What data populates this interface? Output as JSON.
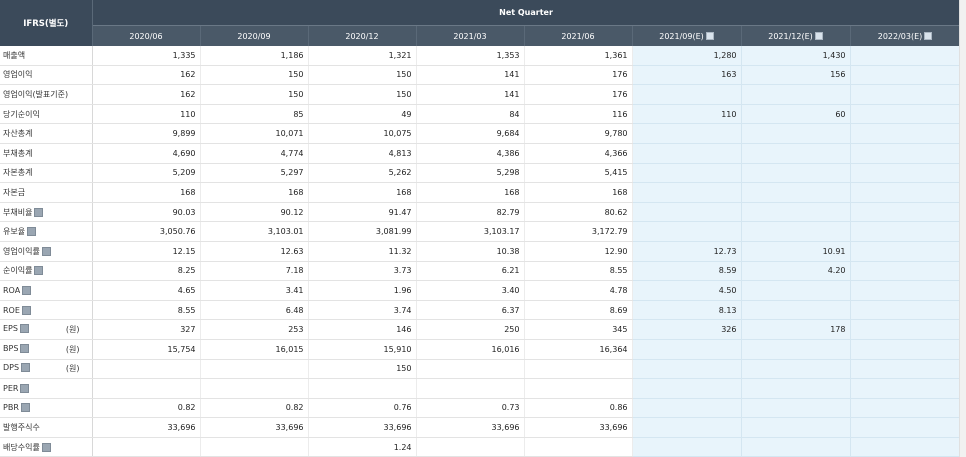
{
  "header": {
    "ifrs_label": "IFRS(별도)",
    "group_label": "Net Quarter",
    "columns": [
      "2020/06",
      "2020/09",
      "2020/12",
      "2021/03",
      "2021/06",
      "2021/09(E)",
      "2021/12(E)",
      "2022/03(E)"
    ]
  },
  "rows": [
    {
      "label": "매출액",
      "info": false,
      "unit": "",
      "values": [
        "1,335",
        "1,186",
        "1,321",
        "1,353",
        "1,361",
        "1,280",
        "1,430",
        ""
      ]
    },
    {
      "label": "영업이익",
      "info": false,
      "unit": "",
      "values": [
        "162",
        "150",
        "150",
        "141",
        "176",
        "163",
        "156",
        ""
      ]
    },
    {
      "label": "영업이익(발표기준)",
      "info": false,
      "unit": "",
      "values": [
        "162",
        "150",
        "150",
        "141",
        "176",
        "",
        "",
        ""
      ]
    },
    {
      "label": "당기순이익",
      "info": false,
      "unit": "",
      "values": [
        "110",
        "85",
        "49",
        "84",
        "116",
        "110",
        "60",
        ""
      ]
    },
    {
      "label": "자산총계",
      "info": false,
      "unit": "",
      "values": [
        "9,899",
        "10,071",
        "10,075",
        "9,684",
        "9,780",
        "",
        "",
        ""
      ]
    },
    {
      "label": "부채총계",
      "info": false,
      "unit": "",
      "values": [
        "4,690",
        "4,774",
        "4,813",
        "4,386",
        "4,366",
        "",
        "",
        ""
      ]
    },
    {
      "label": "자본총계",
      "info": false,
      "unit": "",
      "values": [
        "5,209",
        "5,297",
        "5,262",
        "5,298",
        "5,415",
        "",
        "",
        ""
      ]
    },
    {
      "label": "자본금",
      "info": false,
      "unit": "",
      "values": [
        "168",
        "168",
        "168",
        "168",
        "168",
        "",
        "",
        ""
      ]
    },
    {
      "label": "부채비율",
      "info": true,
      "unit": "",
      "values": [
        "90.03",
        "90.12",
        "91.47",
        "82.79",
        "80.62",
        "",
        "",
        ""
      ]
    },
    {
      "label": "유보율",
      "info": true,
      "unit": "",
      "values": [
        "3,050.76",
        "3,103.01",
        "3,081.99",
        "3,103.17",
        "3,172.79",
        "",
        "",
        ""
      ]
    },
    {
      "label": "영업이익률",
      "info": true,
      "unit": "",
      "values": [
        "12.15",
        "12.63",
        "11.32",
        "10.38",
        "12.90",
        "12.73",
        "10.91",
        ""
      ]
    },
    {
      "label": "순이익률",
      "info": true,
      "unit": "",
      "values": [
        "8.25",
        "7.18",
        "3.73",
        "6.21",
        "8.55",
        "8.59",
        "4.20",
        ""
      ]
    },
    {
      "label": "ROA",
      "info": true,
      "unit": "",
      "values": [
        "4.65",
        "3.41",
        "1.96",
        "3.40",
        "4.78",
        "4.50",
        "",
        ""
      ]
    },
    {
      "label": "ROE",
      "info": true,
      "unit": "",
      "values": [
        "8.55",
        "6.48",
        "3.74",
        "6.37",
        "8.69",
        "8.13",
        "",
        ""
      ]
    },
    {
      "label": "EPS",
      "info": true,
      "unit": "(원)",
      "values": [
        "327",
        "253",
        "146",
        "250",
        "345",
        "326",
        "178",
        ""
      ]
    },
    {
      "label": "BPS",
      "info": true,
      "unit": "(원)",
      "values": [
        "15,754",
        "16,015",
        "15,910",
        "16,016",
        "16,364",
        "",
        "",
        ""
      ]
    },
    {
      "label": "DPS",
      "info": true,
      "unit": "(원)",
      "values": [
        "",
        "",
        "150",
        "",
        "",
        "",
        "",
        ""
      ]
    },
    {
      "label": "PER",
      "info": true,
      "unit": "",
      "values": [
        "",
        "",
        "",
        "",
        "",
        "",
        "",
        ""
      ]
    },
    {
      "label": "PBR",
      "info": true,
      "unit": "",
      "values": [
        "0.82",
        "0.82",
        "0.76",
        "0.73",
        "0.86",
        "",
        "",
        ""
      ]
    },
    {
      "label": "발행주식수",
      "info": false,
      "unit": "",
      "values": [
        "33,696",
        "33,696",
        "33,696",
        "33,696",
        "33,696",
        "",
        "",
        ""
      ]
    },
    {
      "label": "배당수익률",
      "info": true,
      "unit": "",
      "values": [
        "",
        "",
        "1.24",
        "",
        "",
        "",
        "",
        ""
      ]
    }
  ]
}
